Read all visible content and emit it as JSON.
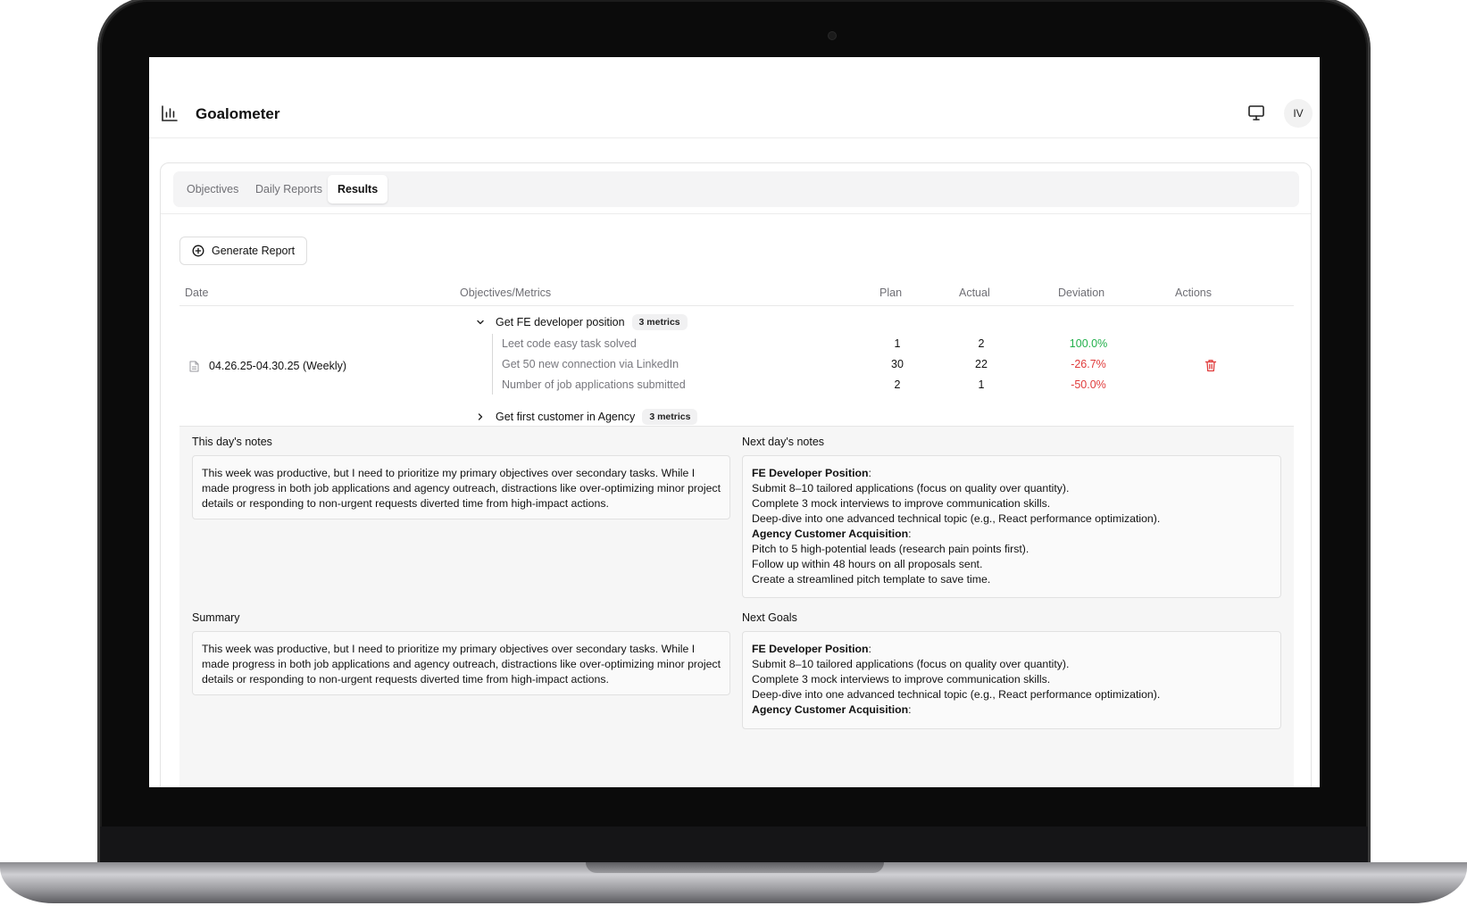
{
  "app": {
    "title": "Goalometer",
    "avatar_initials": "IV"
  },
  "icons": {
    "logo": "bar-chart-icon",
    "display": "monitor-icon",
    "generate": "plus-circle-icon",
    "report": "file-icon",
    "delete": "trash-icon"
  },
  "colors": {
    "positive": "#22b04b",
    "negative": "#e03b3b"
  },
  "tabs": [
    {
      "label": "Objectives",
      "active": false
    },
    {
      "label": "Daily Reports",
      "active": false
    },
    {
      "label": "Results",
      "active": true
    }
  ],
  "toolbar": {
    "generate_label": "Generate Report"
  },
  "table": {
    "headers": {
      "date": "Date",
      "objectives": "Objectives/Metrics",
      "plan": "Plan",
      "actual": "Actual",
      "deviation": "Deviation",
      "actions": "Actions"
    },
    "row": {
      "date": "04.26.25-04.30.25 (Weekly)",
      "objectives": [
        {
          "name": "Get FE developer position",
          "badge": "3 metrics",
          "expanded": true,
          "metrics": [
            {
              "name": "Leet code easy task solved",
              "plan": "1",
              "actual": "2",
              "deviation": "100.0%"
            },
            {
              "name": "Get 50 new connection via LinkedIn",
              "plan": "30",
              "actual": "22",
              "deviation": "-26.7%"
            },
            {
              "name": "Number of job applications submitted",
              "plan": "2",
              "actual": "1",
              "deviation": "-50.0%"
            }
          ]
        },
        {
          "name": "Get first customer in Agency",
          "badge": "3 metrics",
          "expanded": false
        }
      ]
    }
  },
  "notes": {
    "this_day_label": "This day's notes",
    "this_day_text": "This week was productive, but I need to prioritize my primary objectives over secondary tasks. While I made progress in both job applications and agency outreach, distractions like over-optimizing minor project details or responding to non-urgent requests diverted time from high-impact actions.",
    "next_day_label": "Next day's notes",
    "next_day": {
      "heading1": "FE Developer Position",
      "lines1": [
        "Submit 8–10 tailored applications (focus on quality over quantity).",
        "Complete 3 mock interviews to improve communication skills.",
        "Deep-dive into one advanced technical topic (e.g., React performance optimization)."
      ],
      "heading2": "Agency Customer Acquisition",
      "lines2": [
        "Pitch to 5 high-potential leads (research pain points first).",
        "Follow up within 48 hours on all proposals sent.",
        "Create a streamlined pitch template to save time."
      ]
    },
    "summary_label": "Summary",
    "summary_text": "This week was productive, but I need to prioritize my primary objectives over secondary tasks. While I made progress in both job applications and agency outreach, distractions like over-optimizing minor project details or responding to non-urgent requests diverted time from high-impact actions.",
    "next_goals_label": "Next Goals",
    "next_goals": {
      "heading1": "FE Developer Position",
      "lines1": [
        "Submit 8–10 tailored applications (focus on quality over quantity).",
        "Complete 3 mock interviews to improve communication skills.",
        "Deep-dive into one advanced technical topic (e.g., React performance optimization)."
      ],
      "heading2": "Agency Customer Acquisition"
    }
  }
}
